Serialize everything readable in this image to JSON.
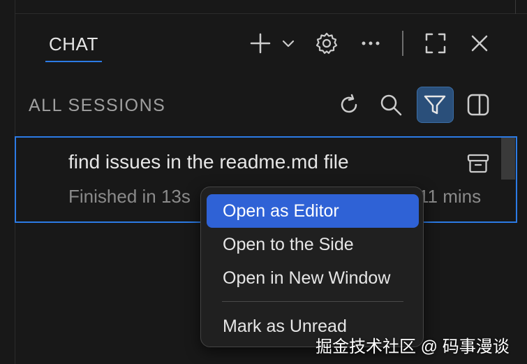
{
  "header": {
    "tab_label": "CHAT",
    "icons": [
      "plus-icon",
      "chevron-down-icon",
      "gear-icon",
      "more-icon",
      "maximize-icon",
      "close-icon"
    ]
  },
  "sessions": {
    "label": "ALL SESSIONS",
    "toolbar_icons": [
      "refresh-icon",
      "search-icon",
      "filter-icon",
      "split-view-icon"
    ]
  },
  "session_item": {
    "title": "find issues in the readme.md file",
    "meta_left": "Finished in 13s",
    "meta_right": "11 mins",
    "action_icon": "archive-icon"
  },
  "context_menu": {
    "items": [
      {
        "label": "Open as Editor",
        "active": true
      },
      {
        "label": "Open to the Side",
        "active": false
      },
      {
        "label": "Open in New Window",
        "active": false
      },
      {
        "label": "Mark as Unread",
        "active": false
      }
    ]
  },
  "watermark": "掘金技术社区 @ 码事漫谈",
  "colors": {
    "accent": "#2c7be5",
    "menu_highlight": "#2f62d6",
    "filter_active_bg": "#2a4f7a",
    "background": "#181818"
  }
}
